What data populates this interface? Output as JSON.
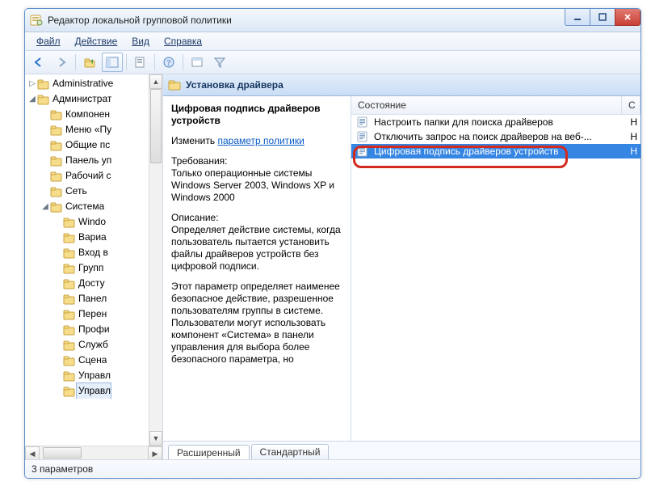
{
  "window": {
    "title": "Редактор локальной групповой политики"
  },
  "menu": {
    "file": "Файл",
    "action": "Действие",
    "view": "Вид",
    "help": "Справка"
  },
  "tree": {
    "items": [
      {
        "indent": 0,
        "tw": "▷",
        "label": "Administrative"
      },
      {
        "indent": 0,
        "tw": "◢",
        "label": "Администрат"
      },
      {
        "indent": 1,
        "tw": "",
        "label": "Компонен"
      },
      {
        "indent": 1,
        "tw": "",
        "label": "Меню «Пу"
      },
      {
        "indent": 1,
        "tw": "",
        "label": "Общие пс"
      },
      {
        "indent": 1,
        "tw": "",
        "label": "Панель уп"
      },
      {
        "indent": 1,
        "tw": "",
        "label": "Рабочий с"
      },
      {
        "indent": 1,
        "tw": "",
        "label": "Сеть"
      },
      {
        "indent": 1,
        "tw": "◢",
        "label": "Система"
      },
      {
        "indent": 2,
        "tw": "",
        "label": "Windo"
      },
      {
        "indent": 2,
        "tw": "",
        "label": "Вариа"
      },
      {
        "indent": 2,
        "tw": "",
        "label": "Вход в"
      },
      {
        "indent": 2,
        "tw": "",
        "label": "Групп"
      },
      {
        "indent": 2,
        "tw": "",
        "label": "Досту"
      },
      {
        "indent": 2,
        "tw": "",
        "label": "Панел"
      },
      {
        "indent": 2,
        "tw": "",
        "label": "Перен"
      },
      {
        "indent": 2,
        "tw": "",
        "label": "Профи"
      },
      {
        "indent": 2,
        "tw": "",
        "label": "Служб"
      },
      {
        "indent": 2,
        "tw": "",
        "label": "Сцена"
      },
      {
        "indent": 2,
        "tw": "",
        "label": "Управл"
      },
      {
        "indent": 2,
        "tw": "",
        "label": "Управл",
        "sel": true
      }
    ]
  },
  "folder_header": "Установка драйвера",
  "desc": {
    "setting_title": "Цифровая подпись драйверов устройств",
    "edit_label": "Изменить",
    "edit_link": "параметр политики",
    "req_label": "Требования:",
    "req_text": "Только операционные системы Windows Server 2003, Windows XP и Windows 2000",
    "desc_label": "Описание:",
    "desc_text1": "Определяет действие системы, когда пользователь пытается установить файлы драйверов устройств без цифровой подписи.",
    "desc_text2": "Этот параметр определяет наименее безопасное действие, разрешенное пользователям группы в системе. Пользователи могут использовать компонент «Система» в панели управления для выбора более безопасного параметра, но"
  },
  "list": {
    "header": {
      "col1": "Состояние",
      "col2": "С"
    },
    "items": [
      {
        "label": "Настроить папки для поиска драйверов",
        "selected": false
      },
      {
        "label": "Отключить запрос на поиск драйверов на веб-...",
        "selected": false
      },
      {
        "label": "Цифровая подпись драйверов устройств",
        "selected": true
      }
    ]
  },
  "tabs": {
    "extended": "Расширенный",
    "standard": "Стандартный"
  },
  "status": "3 параметров"
}
